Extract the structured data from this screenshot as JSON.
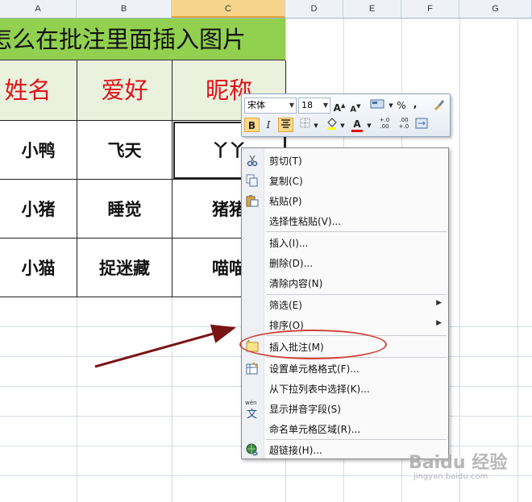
{
  "columns": [
    "A",
    "B",
    "C",
    "D",
    "E",
    "F",
    "G"
  ],
  "title": "怎么在批注里面插入图片",
  "table": {
    "headers": [
      "姓名",
      "爱好",
      "昵称"
    ],
    "rows": [
      [
        "小鸭",
        "飞天",
        "丫丫"
      ],
      [
        "小猪",
        "睡觉",
        "猪猪"
      ],
      [
        "小猫",
        "捉迷藏",
        "喵喵"
      ]
    ]
  },
  "mini_toolbar": {
    "font": "宋体",
    "size": "18",
    "bold": "B",
    "italic": "I",
    "percent": "%",
    "comma": ",",
    "font_color": "A",
    "inc_decimal": "+.0\n.00",
    "dec_decimal": ".00\n+.0"
  },
  "context_menu": {
    "items": [
      {
        "label": "剪切(T)",
        "icon": "scissors-icon"
      },
      {
        "label": "复制(C)",
        "icon": "copy-icon"
      },
      {
        "label": "粘贴(P)",
        "icon": "paste-icon"
      },
      {
        "label": "选择性粘贴(V)...",
        "icon": ""
      },
      {
        "label": "插入(I)...",
        "icon": ""
      },
      {
        "label": "删除(D)...",
        "icon": ""
      },
      {
        "label": "清除内容(N)",
        "icon": ""
      },
      {
        "label": "筛选(E)",
        "icon": "",
        "submenu": true
      },
      {
        "label": "排序(O)",
        "icon": "",
        "submenu": true
      },
      {
        "label": "插入批注(M)",
        "icon": "insert-comment-icon"
      },
      {
        "label": "设置单元格格式(F)...",
        "icon": "format-cells-icon"
      },
      {
        "label": "从下拉列表中选择(K)...",
        "icon": ""
      },
      {
        "label": "显示拼音字段(S)",
        "icon": "phonetic-icon"
      },
      {
        "label": "命名单元格区域(R)...",
        "icon": ""
      },
      {
        "label": "超链接(H)...",
        "icon": "hyperlink-icon"
      }
    ]
  },
  "phonetic_icon_text": {
    "top": "wén",
    "char": "文"
  },
  "watermark": {
    "main": "Baidu 经验",
    "sub": "jingyan.baidu.com"
  },
  "colors": {
    "title_bg": "#92d050",
    "header_bg": "#eaf1dd",
    "header_text": "#e0121b",
    "annotation": "#d2433c",
    "arrow": "#7a1414"
  }
}
